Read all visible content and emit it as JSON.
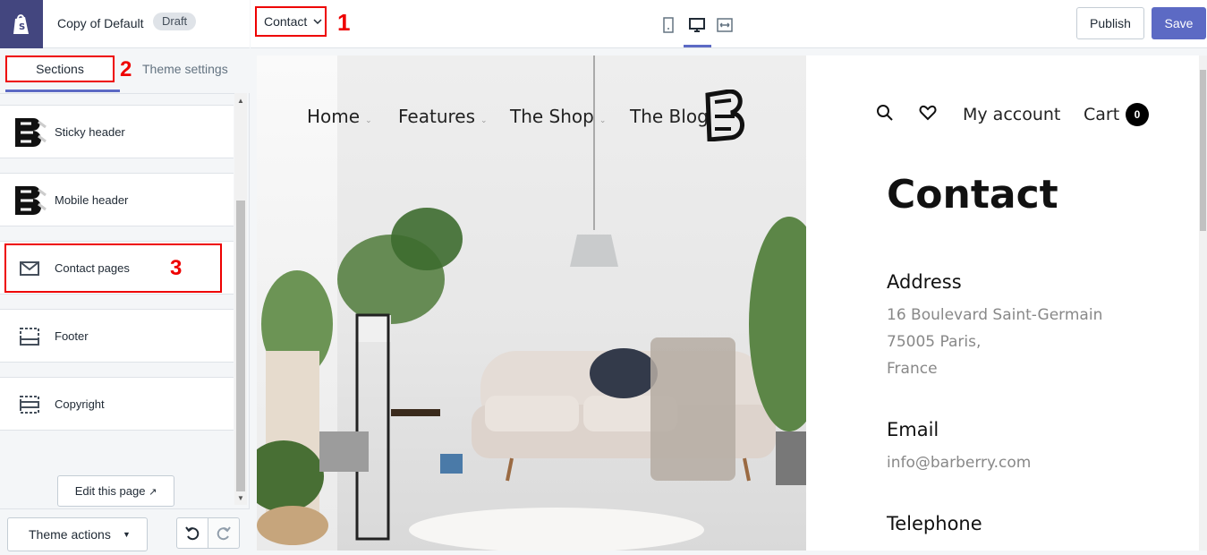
{
  "brand": {
    "theme_name": "Copy of Default",
    "badge": "Draft"
  },
  "tabs": {
    "sections": "Sections",
    "theme_settings": "Theme settings"
  },
  "annotations": {
    "a1": "1",
    "a2": "2",
    "a3": "3"
  },
  "sections": [
    {
      "label": "Sticky header",
      "icon": "brand-logo-icon"
    },
    {
      "label": "Mobile header",
      "icon": "brand-logo-icon"
    },
    {
      "label": "Contact pages",
      "icon": "envelope-icon"
    },
    {
      "label": "Footer",
      "icon": "footer-section-icon"
    },
    {
      "label": "Copyright",
      "icon": "copyright-section-icon"
    }
  ],
  "edit_page": "Edit this page",
  "theme_actions": "Theme actions",
  "topbar": {
    "page_select": "Contact",
    "publish": "Publish",
    "save": "Save"
  },
  "preview": {
    "nav": [
      "Home",
      "Features",
      "The Shop",
      "The Blog"
    ],
    "account": "My account",
    "cart": "Cart",
    "cart_count": "0",
    "title": "Contact",
    "address_heading": "Address",
    "address_lines": [
      "16 Boulevard Saint-Germain",
      "75005 Paris,",
      "France"
    ],
    "email_heading": "Email",
    "email": "info@barberry.com",
    "telephone_heading": "Telephone"
  },
  "colors": {
    "accent": "#5c6ac4",
    "brand_bg": "#43467f",
    "annotation": "#ee0000"
  }
}
